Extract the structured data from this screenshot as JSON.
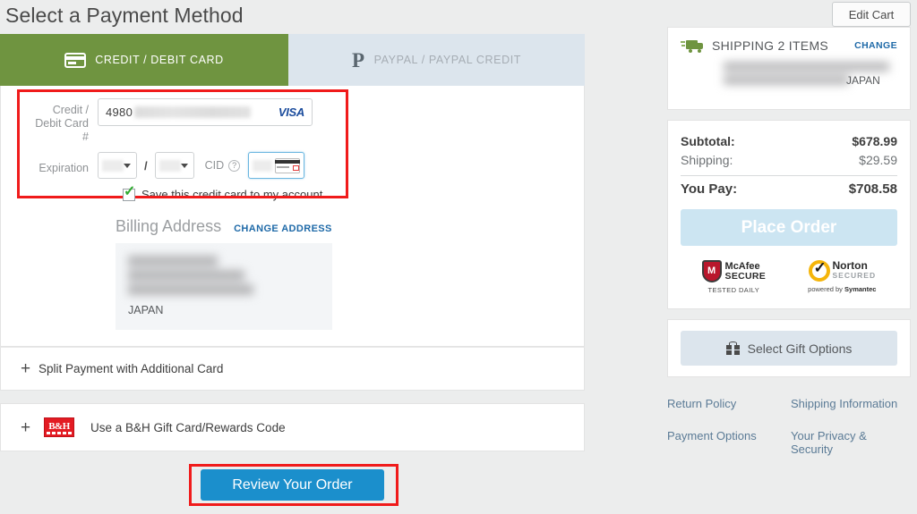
{
  "header": {
    "title": "Select a Payment Method",
    "edit_cart_label": "Edit Cart"
  },
  "tabs": [
    {
      "id": "credit-debit",
      "label": "CREDIT / DEBIT CARD",
      "icon": "credit-card-icon",
      "active": true
    },
    {
      "id": "paypal",
      "label": "PAYPAL / PAYPAL CREDIT",
      "icon": "paypal-icon",
      "active": false
    }
  ],
  "card_form": {
    "card_number_label": "Credit / Debit Card #",
    "card_number_value": "4980",
    "card_brand": "VISA",
    "expiration_label": "Expiration",
    "expiration_month_value": "",
    "expiration_year_value": "",
    "separator": "/",
    "cid_label": "CID",
    "cid_help_icon": "question-mark-icon",
    "cid_value": "",
    "save_card_label": "Save this credit card to my account.",
    "save_card_checked": true
  },
  "billing": {
    "title": "Billing Address",
    "change_link": "CHANGE ADDRESS",
    "country": "JAPAN"
  },
  "accordions": [
    {
      "id": "split-payment",
      "icon": "plus-icon",
      "label": "Split Payment with Additional Card"
    },
    {
      "id": "gift-card",
      "icon": "plus-icon",
      "brand_icon": "bh-logo-icon",
      "brand_text": "B&H",
      "label": "Use a B&H Gift Card/Rewards Code"
    }
  ],
  "review_button": {
    "label": "Review Your Order"
  },
  "shipping": {
    "title": "SHIPPING 2 ITEMS",
    "change_link": "CHANGE",
    "country": "JAPAN",
    "truck_icon": "shipping-truck-icon"
  },
  "totals": {
    "subtotal_label": "Subtotal:",
    "subtotal_value": "$678.99",
    "shipping_label": "Shipping:",
    "shipping_value": "$29.59",
    "you_pay_label": "You Pay:",
    "you_pay_value": "$708.58",
    "place_order_label": "Place Order"
  },
  "badges": [
    {
      "id": "mcafee",
      "mark": "M",
      "line1": "McAfee",
      "line2": "SECURE",
      "sub": "TESTED DAILY"
    },
    {
      "id": "norton",
      "line1": "Norton",
      "line2": "SECURED",
      "sub_prefix": "powered by ",
      "sub_brand": "Symantec"
    }
  ],
  "gift_options": {
    "label": "Select Gift Options",
    "icon": "gift-icon"
  },
  "footer_links": [
    "Return Policy",
    "Shipping Information",
    "Payment Options",
    "Your Privacy & Security"
  ],
  "colors": {
    "tab_active": "#6f9440",
    "tab_inactive": "#dce5ed",
    "primary_button": "#1b8fcc",
    "place_order_disabled": "#cce5f2",
    "highlight_box": "#f01b1b",
    "link": "#1f6aa8",
    "page_background": "#eceded"
  }
}
